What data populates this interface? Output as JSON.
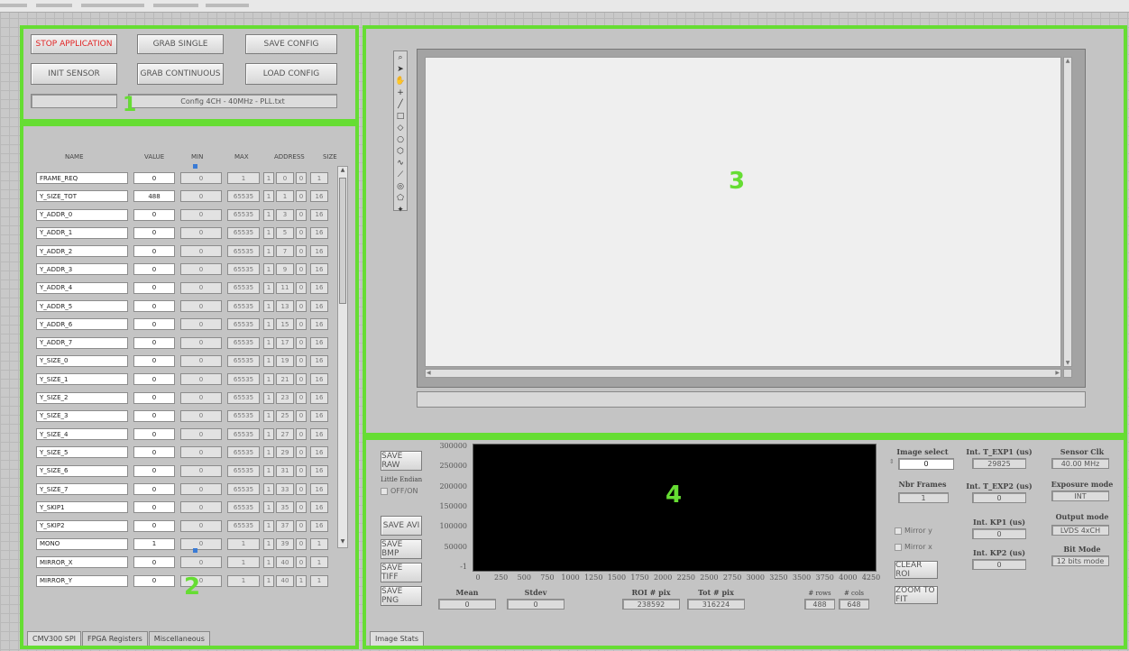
{
  "colors": {
    "panel_border": "#66dd33",
    "stop_text": "#e02424"
  },
  "panel1": {
    "number": "1",
    "buttons": {
      "stop": "STOP APPLICATION",
      "grab_single": "GRAB SINGLE",
      "save_config": "SAVE CONFIG",
      "init_sensor": "INIT SENSOR",
      "grab_continuous": "GRAB CONTINUOUS",
      "load_config": "LOAD CONFIG"
    },
    "status_field": "",
    "config_file": "Config 4CH - 40MHz - PLL.txt"
  },
  "panel2": {
    "number": "2",
    "headers": {
      "name": "NAME",
      "value": "VALUE",
      "min": "MIN",
      "max": "MAX",
      "address": "ADDRESS",
      "size": "SIZE"
    },
    "rows": [
      [
        "FRAME_REQ",
        "0",
        "0",
        "1",
        "1",
        "0",
        "0",
        "1"
      ],
      [
        "Y_SIZE_TOT",
        "488",
        "0",
        "65535",
        "1",
        "1",
        "0",
        "16"
      ],
      [
        "Y_ADDR_0",
        "0",
        "0",
        "65535",
        "1",
        "3",
        "0",
        "16"
      ],
      [
        "Y_ADDR_1",
        "0",
        "0",
        "65535",
        "1",
        "5",
        "0",
        "16"
      ],
      [
        "Y_ADDR_2",
        "0",
        "0",
        "65535",
        "1",
        "7",
        "0",
        "16"
      ],
      [
        "Y_ADDR_3",
        "0",
        "0",
        "65535",
        "1",
        "9",
        "0",
        "16"
      ],
      [
        "Y_ADDR_4",
        "0",
        "0",
        "65535",
        "1",
        "11",
        "0",
        "16"
      ],
      [
        "Y_ADDR_5",
        "0",
        "0",
        "65535",
        "1",
        "13",
        "0",
        "16"
      ],
      [
        "Y_ADDR_6",
        "0",
        "0",
        "65535",
        "1",
        "15",
        "0",
        "16"
      ],
      [
        "Y_ADDR_7",
        "0",
        "0",
        "65535",
        "1",
        "17",
        "0",
        "16"
      ],
      [
        "Y_SIZE_0",
        "0",
        "0",
        "65535",
        "1",
        "19",
        "0",
        "16"
      ],
      [
        "Y_SIZE_1",
        "0",
        "0",
        "65535",
        "1",
        "21",
        "0",
        "16"
      ],
      [
        "Y_SIZE_2",
        "0",
        "0",
        "65535",
        "1",
        "23",
        "0",
        "16"
      ],
      [
        "Y_SIZE_3",
        "0",
        "0",
        "65535",
        "1",
        "25",
        "0",
        "16"
      ],
      [
        "Y_SIZE_4",
        "0",
        "0",
        "65535",
        "1",
        "27",
        "0",
        "16"
      ],
      [
        "Y_SIZE_5",
        "0",
        "0",
        "65535",
        "1",
        "29",
        "0",
        "16"
      ],
      [
        "Y_SIZE_6",
        "0",
        "0",
        "65535",
        "1",
        "31",
        "0",
        "16"
      ],
      [
        "Y_SIZE_7",
        "0",
        "0",
        "65535",
        "1",
        "33",
        "0",
        "16"
      ],
      [
        "Y_SKIP1",
        "0",
        "0",
        "65535",
        "1",
        "35",
        "0",
        "16"
      ],
      [
        "Y_SKIP2",
        "0",
        "0",
        "65535",
        "1",
        "37",
        "0",
        "16"
      ],
      [
        "MONO",
        "1",
        "0",
        "1",
        "1",
        "39",
        "0",
        "1"
      ],
      [
        "MIRROR_X",
        "0",
        "0",
        "1",
        "1",
        "40",
        "0",
        "1"
      ],
      [
        "MIRROR_Y",
        "0",
        "0",
        "1",
        "1",
        "40",
        "1",
        "1"
      ]
    ],
    "tabs": [
      "CMV300 SPI",
      "FPGA Registers",
      "Miscellaneous"
    ]
  },
  "panel3": {
    "number": "3",
    "tool_icons": [
      "zoom-icon",
      "pointer-icon",
      "pan-icon",
      "crosshair-icon",
      "line-icon",
      "rectangle-icon",
      "rotated-rect-icon",
      "oval-icon",
      "polygon-icon",
      "freehand-icon",
      "polyline-icon",
      "annulus-icon",
      "broken-rect-icon",
      "point-icon"
    ],
    "tool_glyphs": [
      "⌕",
      "➤",
      "✋",
      "+",
      "╱",
      "□",
      "◇",
      "○",
      "⬡",
      "∿",
      "⟋",
      "◎",
      "⬠",
      "✦"
    ]
  },
  "panel4": {
    "number": "4",
    "buttons": {
      "save_raw": "SAVE RAW",
      "save_avi": "SAVE AVI",
      "save_bmp": "SAVE BMP",
      "save_tiff": "SAVE TIFF",
      "save_png": "SAVE PNG",
      "clear_roi": "CLEAR ROI",
      "zoom_to_fit": "ZOOM TO FIT"
    },
    "little_endian": {
      "label": "Little Endian",
      "state": "OFF/ON"
    },
    "chart_data": {
      "type": "line",
      "title": "",
      "xlabel": "",
      "ylabel": "",
      "x_ticks": [
        "0",
        "250",
        "500",
        "750",
        "1000",
        "1250",
        "1500",
        "1750",
        "2000",
        "2250",
        "2500",
        "2750",
        "3000",
        "3250",
        "3500",
        "3750",
        "4000",
        "4250"
      ],
      "y_ticks": [
        "300000",
        "250000",
        "200000",
        "150000",
        "100000",
        "50000",
        "-1"
      ],
      "xlim": [
        0,
        4250
      ],
      "ylim": [
        -1,
        300000
      ],
      "series": []
    },
    "stats": {
      "mean_label": "Mean",
      "mean": "0",
      "stdev_label": "Stdev",
      "stdev": "0",
      "roi_label": "ROI # pix",
      "roi": "238592",
      "tot_label": "Tot # pix",
      "tot": "316224",
      "rows_label": "# rows",
      "rows": "488",
      "cols_label": "# cols",
      "cols": "648"
    },
    "image_select": {
      "label": "Image select",
      "value": "0"
    },
    "nbr_frames": {
      "label": "Nbr Frames",
      "value": "1"
    },
    "mirror_y": "Mirror y",
    "mirror_x": "Mirror x",
    "int_t_exp1": {
      "label": "Int. T_EXP1 (us)",
      "value": "29825"
    },
    "int_t_exp2": {
      "label": "Int. T_EXP2 (us)",
      "value": "0"
    },
    "int_kp1": {
      "label": "Int. KP1 (us)",
      "value": "0"
    },
    "int_kp2": {
      "label": "Int. KP2 (us)",
      "value": "0"
    },
    "sensor_clk": {
      "label": "Sensor Clk",
      "value": "40.00 MHz"
    },
    "exposure_mode": {
      "label": "Exposure mode",
      "value": "INT"
    },
    "output_mode": {
      "label": "Output mode",
      "value": "LVDS 4xCH"
    },
    "bit_mode": {
      "label": "Bit Mode",
      "value": "12 bits mode"
    },
    "tab": "Image Stats"
  }
}
